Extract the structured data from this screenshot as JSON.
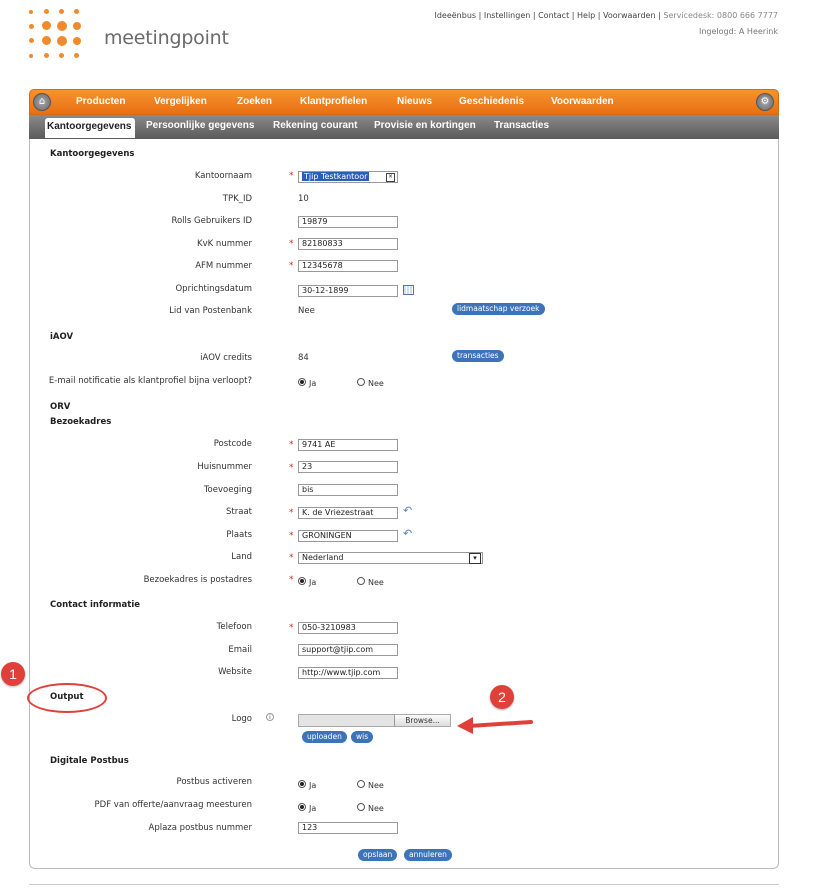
{
  "brand": {
    "name": "meetingpoint"
  },
  "toplinks": {
    "ideeenbus": "Ideeënbus",
    "instellingen": "Instellingen",
    "contact": "Contact",
    "help": "Help",
    "voorwaarden": "Voorwaarden",
    "servicedesk": "Servicedesk: 0800 666 7777",
    "ingelogd": "Ingelogd: A Heerink"
  },
  "mainnav": [
    "Producten",
    "Vergelijken",
    "Zoeken",
    "Klantprofielen",
    "Nieuws",
    "Geschiedenis",
    "Voorwaarden"
  ],
  "subnav": [
    "Kantoorgegevens",
    "Persoonlijke gegevens",
    "Rekening courant",
    "Provisie en kortingen",
    "Transacties"
  ],
  "sections": {
    "kantoor": "Kantoorgegevens",
    "iaov": "iAOV",
    "orv": "ORV",
    "bezoek": "Bezoekadres",
    "contact": "Contact informatie",
    "output": "Output",
    "postbus": "Digitale Postbus"
  },
  "fields": {
    "kantoornaam": {
      "label": "Kantoornaam",
      "value": "Tjip Testkantoor"
    },
    "tpk": {
      "label": "TPK_ID",
      "value": "10"
    },
    "rolls": {
      "label": "Rolls Gebruikers ID",
      "value": "19879"
    },
    "kvk": {
      "label": "KvK nummer",
      "value": "82180833"
    },
    "afm": {
      "label": "AFM nummer",
      "value": "12345678"
    },
    "oprichting": {
      "label": "Oprichtingsdatum",
      "value": "30-12-1899"
    },
    "postenbank": {
      "label": "Lid van Postenbank",
      "value": "Nee",
      "button": "lidmaatschap verzoek"
    },
    "iaovcredits": {
      "label": "iAOV credits",
      "value": "84",
      "button": "transacties"
    },
    "emailnotif": {
      "label": "E-mail notificatie als klantprofiel bijna verloopt?",
      "yes": "Ja",
      "no": "Nee"
    },
    "postcode": {
      "label": "Postcode",
      "value": "9741 AE"
    },
    "huisnummer": {
      "label": "Huisnummer",
      "value": "23"
    },
    "toevoeging": {
      "label": "Toevoeging",
      "value": "bis"
    },
    "straat": {
      "label": "Straat",
      "value": "K. de Vriezestraat"
    },
    "plaats": {
      "label": "Plaats",
      "value": "GRONINGEN"
    },
    "land": {
      "label": "Land",
      "value": "Nederland"
    },
    "postadres": {
      "label": "Bezoekadres is postadres",
      "yes": "Ja",
      "no": "Nee"
    },
    "telefoon": {
      "label": "Telefoon",
      "value": "050-3210983"
    },
    "email": {
      "label": "Email",
      "value": "support@tjip.com"
    },
    "website": {
      "label": "Website",
      "value": "http://www.tjip.com"
    },
    "logo": {
      "label": "Logo",
      "browse": "Browse...",
      "upload": "uploaden",
      "wis": "wis"
    },
    "postbusact": {
      "label": "Postbus activeren",
      "yes": "Ja",
      "no": "Nee"
    },
    "pdf": {
      "label": "PDF van offerte/aanvraag meesturen",
      "yes": "Ja",
      "no": "Nee"
    },
    "aplaza": {
      "label": "Aplaza postbus nummer",
      "value": "123"
    }
  },
  "actions": {
    "save": "opslaan",
    "cancel": "annuleren"
  },
  "annotations": {
    "one": "1",
    "two": "2"
  },
  "colors": {
    "accent": "#f08a2c",
    "button": "#3d73b8",
    "annotation": "#e0403a"
  }
}
